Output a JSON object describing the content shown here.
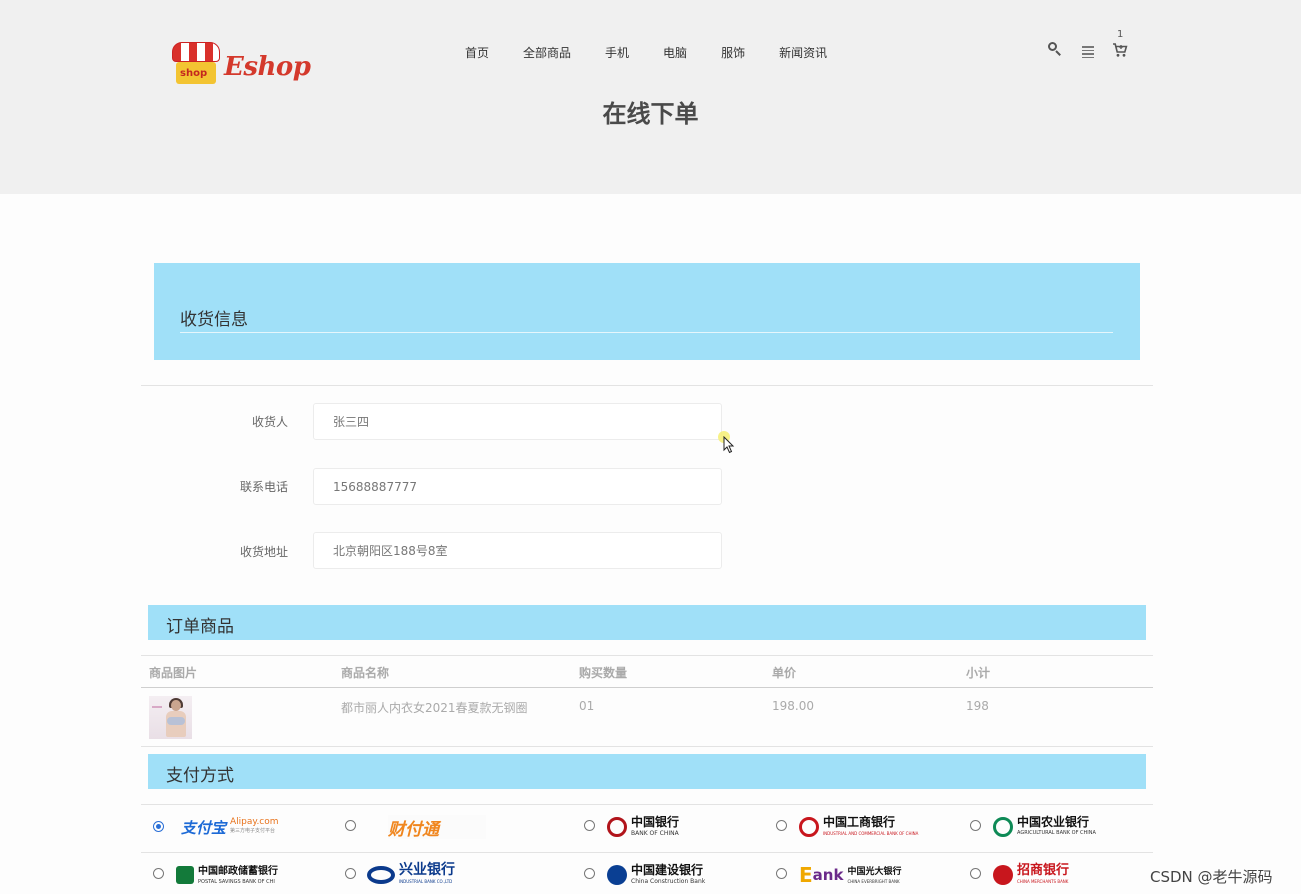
{
  "header": {
    "logo_text": "Eshop",
    "logo_badge": "shop",
    "nav": [
      "首页",
      "全部商品",
      "手机",
      "电脑",
      "服饰",
      "新闻资讯"
    ],
    "cart_count": "1",
    "icons": [
      "search-icon",
      "menu-icon",
      "cart-icon"
    ]
  },
  "page": {
    "title": "在线下单"
  },
  "shipping": {
    "section_title": "收货信息",
    "fields": [
      {
        "label": "收货人",
        "value": "张三四"
      },
      {
        "label": "联系电话",
        "value": "15688887777"
      },
      {
        "label": "收货地址",
        "value": "北京朝阳区188号8室"
      }
    ]
  },
  "order": {
    "section_title": "订单商品",
    "columns": [
      "商品图片",
      "商品名称",
      "购买数量",
      "单价",
      "小计"
    ],
    "rows": [
      {
        "name": "都市丽人内衣女2021春夏款无钢圈",
        "quantity": "01",
        "price": "198.00",
        "subtotal": "198"
      }
    ]
  },
  "payment": {
    "section_title": "支付方式",
    "selected": "alipay",
    "options": [
      {
        "id": "alipay",
        "name": "支付宝",
        "sub": "Alipay.com",
        "sub2": "第三方电子支付平台",
        "color": "#1d6ad6"
      },
      {
        "id": "tenpay",
        "name": "财付通",
        "sub": "",
        "sub2": "",
        "color": "#f0861e"
      },
      {
        "id": "boc",
        "name": "中国银行",
        "sub": "BANK OF CHINA",
        "sub2": "",
        "color": "#b1141b"
      },
      {
        "id": "icbc",
        "name": "中国工商银行",
        "sub": "INDUSTRIAL AND COMMERCIAL BANK OF CHINA",
        "sub2": "",
        "color": "#c8161d"
      },
      {
        "id": "abc",
        "name": "中国农业银行",
        "sub": "AGRICULTURAL BANK OF CHINA",
        "sub2": "",
        "color": "#0e8a56"
      },
      {
        "id": "psbc",
        "name": "中国邮政储蓄银行",
        "sub": "POSTAL SAVINGS BANK OF CHI",
        "sub2": "",
        "color": "#137a3a"
      },
      {
        "id": "cib",
        "name": "兴业银行",
        "sub": "INDUSTRIAL BANK CO.,LTD",
        "sub2": "",
        "color": "#0b3a8c"
      },
      {
        "id": "ccb",
        "name": "中国建设银行",
        "sub": "China Construction Bank",
        "sub2": "",
        "color": "#0a3f93"
      },
      {
        "id": "ceb",
        "name": "中国光大银行",
        "sub": "CHINA EVERBRIGHT BANK",
        "sub2": "",
        "color": "#6b2a8a"
      },
      {
        "id": "cmb",
        "name": "招商银行",
        "sub": "CHINA MERCHANTS BANK",
        "sub2": "",
        "color": "#c8161d"
      }
    ]
  },
  "watermark": "CSDN @老牛源码"
}
